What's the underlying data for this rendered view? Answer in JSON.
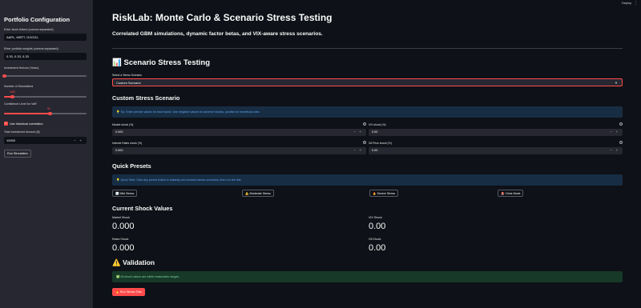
{
  "topbar": {
    "deploy_label": "Deploy",
    "kebab": "⋮"
  },
  "sidebar": {
    "title": "Portfolio Configuration",
    "tickers_label": "Enter stock tickers (comma separated)",
    "tickers_value": "AAPL, MSFT, GOOGL",
    "weights_label": "Enter portfolio weights (comma separated)",
    "weights_value": "0.33, 0.33, 0.33",
    "horizon_label": "Investment Horizon (Years)",
    "sims_label": "Number of Simulations",
    "sims_value": "1000",
    "conf_label": "Confidence Level for VaR",
    "conf_value": "95",
    "hist_label": "Use historical correlation",
    "hist_checked": true,
    "invest_label": "Total Investment Amount ($)",
    "invest_value": "10000",
    "run_label": "Run Simulation"
  },
  "main": {
    "title": "RiskLab: Monte Carlo & Scenario Stress Testing",
    "subtitle": "Correlated GBM simulations, dynamic factor betas, and VIX-aware stress scenarios.",
    "stress_icon": "📊",
    "stress_heading": "Scenario Stress Testing",
    "scenario_label": "Select a Stress Scenario",
    "scenario_value": "Custom Scenario",
    "custom_heading": "Custom Stress Scenario",
    "tip_icon": "💡",
    "tip_text": "Tip: Enter precise values for each factor. Use negative values for adverse shocks, positive for beneficial ones.",
    "inputs": [
      {
        "label": "Market shock (%)",
        "value": "0.000"
      },
      {
        "label": "VIX shock (%)",
        "value": "0.00"
      },
      {
        "label": "Interest Rates shock (%)",
        "value": "0.000"
      },
      {
        "label": "Oil Price shock (%)",
        "value": "0.00"
      }
    ],
    "presets_heading": "Quick Presets",
    "quickstart_icon": "💡",
    "quickstart_text": "Quick Start: Click any preset button to instantly set common stress scenarios, then run the test.",
    "presets": [
      {
        "icon": "📉",
        "label": "Mild Stress"
      },
      {
        "icon": "⚠️",
        "label": "Moderate Stress"
      },
      {
        "icon": "🔥",
        "label": "Severe Stress"
      },
      {
        "icon": "🚨",
        "label": "Crisis Mode"
      }
    ],
    "shock_heading": "Current Shock Values",
    "metrics": [
      {
        "label": "Market Shock",
        "value": "0.000"
      },
      {
        "label": "VIX Shock",
        "value": "0.00"
      },
      {
        "label": "Rates Shock",
        "value": "0.000"
      },
      {
        "label": "Oil Shock",
        "value": "0.00"
      }
    ],
    "validation_icon": "⚠️",
    "validation_heading": "Validation",
    "success_icon": "✅",
    "success_text": "All shock values are within reasonable ranges.",
    "run_icon": "🔥",
    "run_label": "Run Stress Test",
    "colors": {
      "accent": "#ff4b4b",
      "info_bg": "#172d43",
      "success_bg": "#173928",
      "sidebar_bg": "#262730",
      "page_bg": "#0e1117"
    }
  }
}
